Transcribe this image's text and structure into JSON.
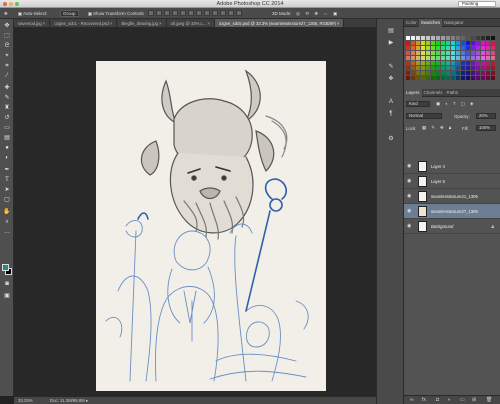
{
  "titlebar": {
    "title": "Adobe Photoshop CC 2014",
    "workspace": "Painting"
  },
  "options": {
    "auto_select_label": "Auto-Select:",
    "auto_select_value": "Group",
    "transform_label": "Show Transform Controls",
    "mode_label": "3D Mode:"
  },
  "tabs": [
    {
      "label": "savemod.jpg ×"
    },
    {
      "label": "ozgne_sdc1 - Recovered.psd ×"
    },
    {
      "label": "Biegfie_drawing.jpg ×"
    },
    {
      "label": "orl.jpeg @ 33% L... ×"
    },
    {
      "label": "ozgne_sdc5.psd @ 33.3% (seamlesstexture27_1306, RGB/8#) ×"
    }
  ],
  "status": {
    "zoom": "33.33%",
    "doc": "Doc: 11.3M/98.8M"
  },
  "panels": {
    "top_tabs": [
      "Color",
      "Swatches",
      "Navigator"
    ],
    "layer_tabs": [
      "Layers",
      "Channels",
      "Paths"
    ],
    "kind_label": "Kind",
    "blend_mode": "Normal",
    "opacity_label": "Opacity:",
    "opacity_value": "20%",
    "lock_label": "Lock:",
    "fill_label": "Fill:",
    "fill_value": "100%"
  },
  "layers": [
    {
      "name": "Layer 4",
      "selected": false
    },
    {
      "name": "Layer 5",
      "selected": false
    },
    {
      "name": "seamlesstexture21_1306",
      "selected": false
    },
    {
      "name": "seamlesstexture27_1306",
      "selected": true
    },
    {
      "name": "Background",
      "italic": true,
      "selected": false
    }
  ],
  "colors": {
    "foreground": "#1a8f85",
    "background": "#000000",
    "accent_selected_layer": "#6d7d93"
  }
}
